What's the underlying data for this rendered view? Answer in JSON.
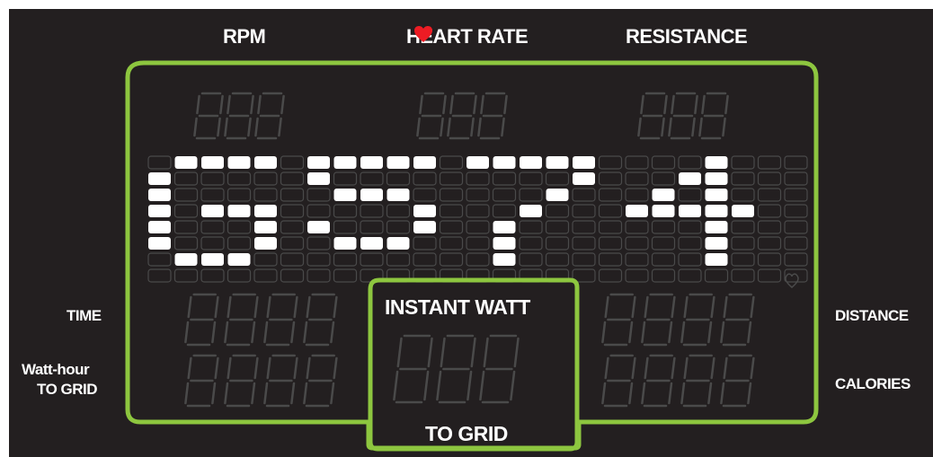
{
  "header": {
    "rpm_label": "RPM",
    "heart_rate_label": "HEART RATE",
    "resistance_label": "RESISTANCE"
  },
  "left_labels": {
    "time": "TIME",
    "watt_hour_line1": "Watt-hour",
    "watt_hour_line2": "TO GRID"
  },
  "right_labels": {
    "distance": "DISTANCE",
    "calories": "CALORIES"
  },
  "center_panel": {
    "title": "INSTANT WATT",
    "subtitle": "TO GRID"
  },
  "matrix_display": {
    "text": "GSR4"
  },
  "icons": {
    "heart": "heart-icon",
    "small_heart": "heart-outline-icon"
  },
  "colors": {
    "background": "#231f20",
    "frame": "#8dc63f",
    "lit": "#ffffff",
    "unlit": "#4a4a4a",
    "heart": "#ed1c24"
  }
}
